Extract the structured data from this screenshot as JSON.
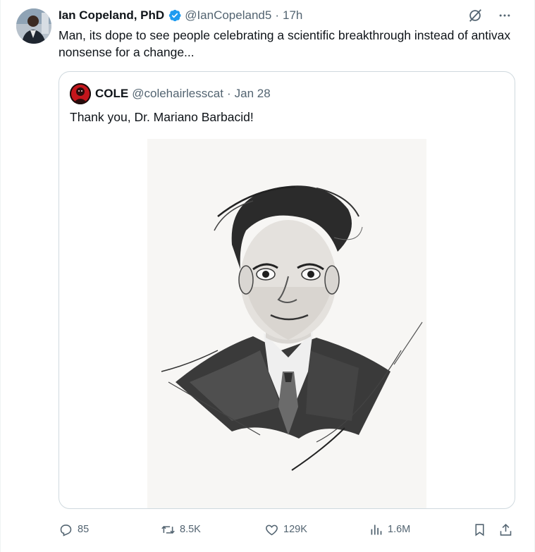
{
  "author": {
    "display_name": "Ian Copeland, PhD",
    "handle": "@IanCopeland5",
    "separator": "·",
    "time": "17h",
    "verified": true,
    "verified_color": "#1d9bf0"
  },
  "tweet": {
    "text": "Man, its dope to see people celebrating a scientific breakthrough instead of antivax nonsense for a change..."
  },
  "top_actions": [
    {
      "name": "grok-icon"
    },
    {
      "name": "more-icon",
      "glyph": "···"
    }
  ],
  "quote": {
    "display_name": "COLE",
    "handle": "@colehairlesscat",
    "separator": "·",
    "date": "Jan 28",
    "text": "Thank you, Dr. Mariano Barbacid!",
    "image_description_icon": "sketch-portrait"
  },
  "actions": {
    "replies": "85",
    "retweets": "8.5K",
    "likes": "129K",
    "views": "1.6M"
  },
  "colors": {
    "text_primary": "#0f1419",
    "text_secondary": "#536471",
    "border": "#cfd9de",
    "accent": "#1d9bf0"
  }
}
